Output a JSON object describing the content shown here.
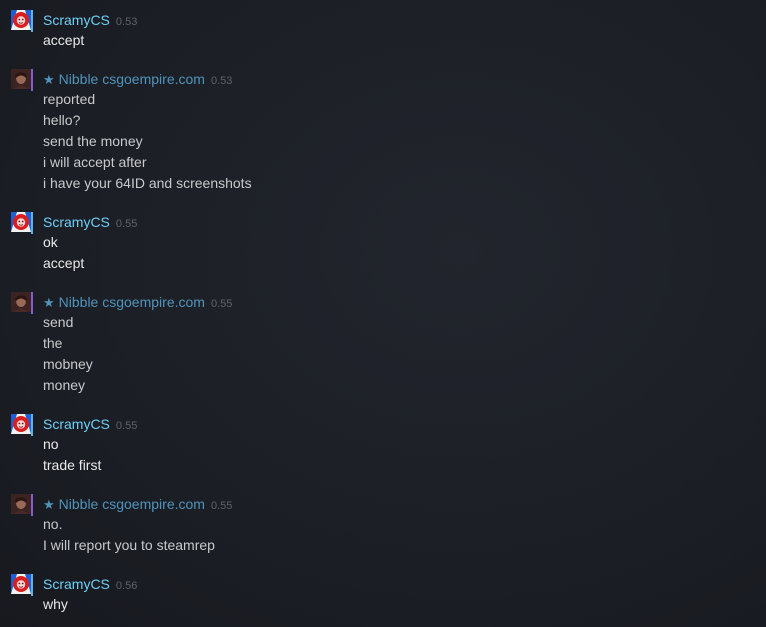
{
  "self": {
    "name": "ScramyCS",
    "avatar_icon": "red-lion-avatar-icon",
    "accent_color": "#6dcff6"
  },
  "friend": {
    "star": "★",
    "name": "Nibble csgoempire.com",
    "avatar_icon": "person-avatar-icon",
    "accent_color": "#4f94bc"
  },
  "messages": [
    {
      "sender": "ScramyCS",
      "time": "0.53",
      "lines": [
        "accept"
      ]
    },
    {
      "sender": "Nibble csgoempire.com",
      "time": "0.53",
      "lines": [
        "reported",
        "hello?",
        "send the money",
        "i will accept after",
        "i have your 64ID and screenshots"
      ]
    },
    {
      "sender": "ScramyCS",
      "time": "0.55",
      "lines": [
        "ok",
        "accept"
      ]
    },
    {
      "sender": "Nibble csgoempire.com",
      "time": "0.55",
      "lines": [
        "send",
        "the",
        "mobney",
        "money"
      ]
    },
    {
      "sender": "ScramyCS",
      "time": "0.55",
      "lines": [
        "no",
        "trade first"
      ]
    },
    {
      "sender": "Nibble csgoempire.com",
      "time": "0.55",
      "lines": [
        "no.",
        "I will report you to steamrep"
      ]
    },
    {
      "sender": "ScramyCS",
      "time": "0.56",
      "lines": [
        "why"
      ]
    }
  ]
}
